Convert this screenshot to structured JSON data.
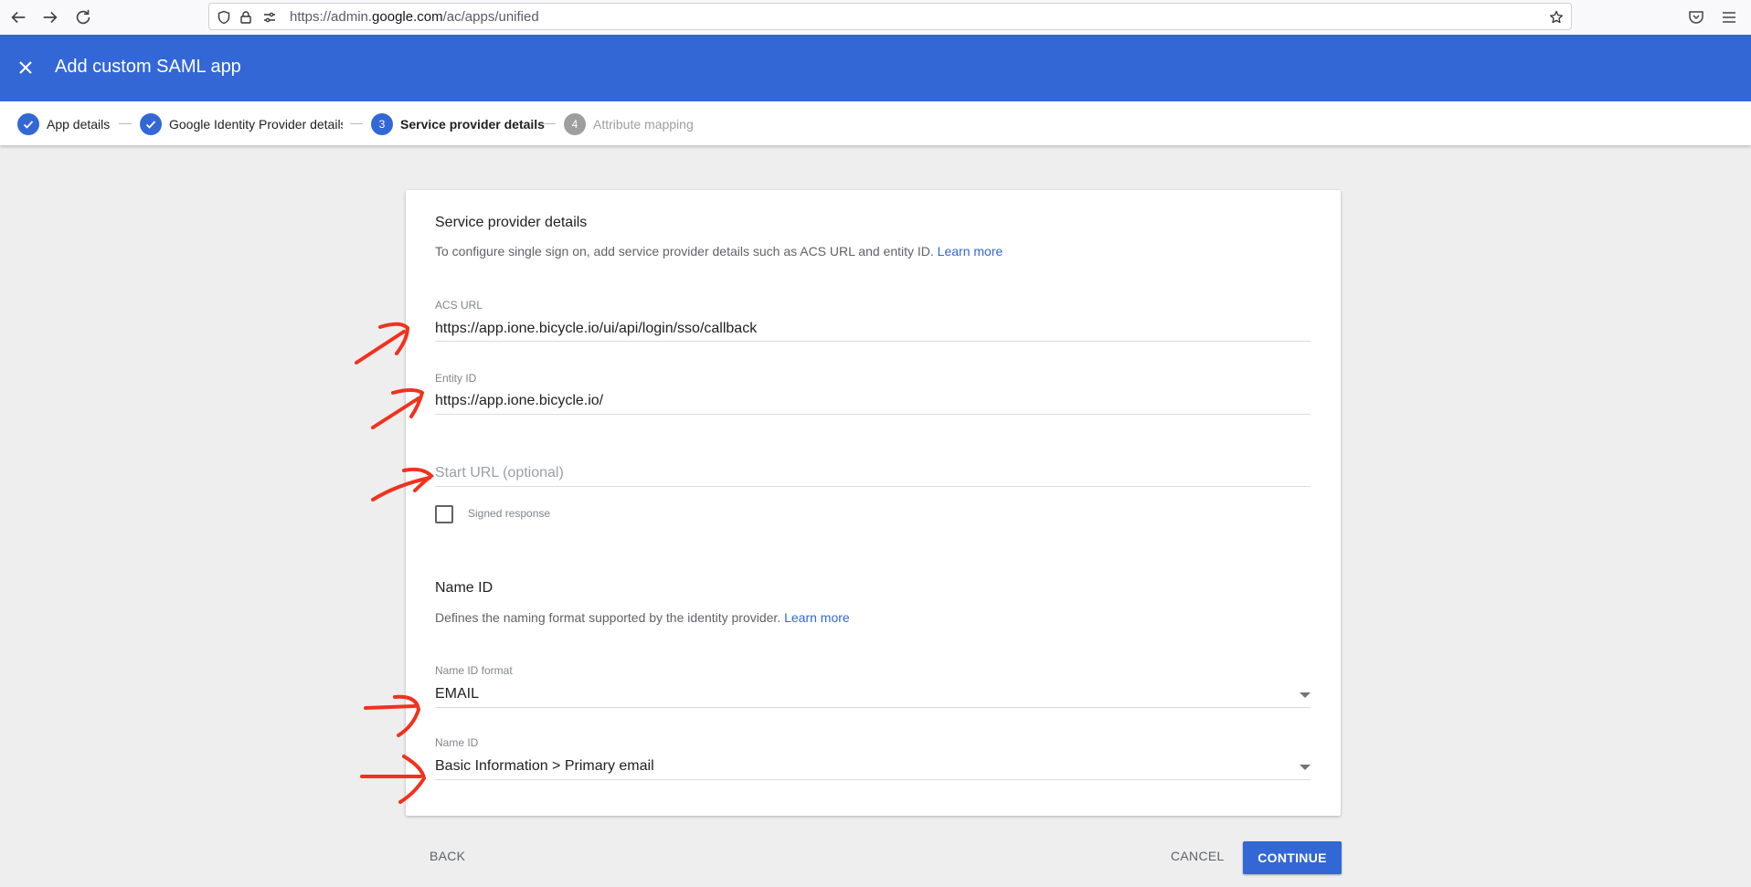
{
  "browser": {
    "url_prefix": "https://admin.",
    "url_domain": "google.com",
    "url_path": "/ac/apps/unified"
  },
  "header": {
    "title": "Add custom SAML app"
  },
  "stepper": {
    "steps": [
      {
        "number": "1",
        "label": "App details",
        "state": "done"
      },
      {
        "number": "2",
        "label": "Google Identity Provider details",
        "state": "done"
      },
      {
        "number": "3",
        "label": "Service provider details",
        "state": "active"
      },
      {
        "number": "4",
        "label": "Attribute mapping",
        "state": "inactive"
      }
    ]
  },
  "card": {
    "sp_title": "Service provider details",
    "sp_desc": "To configure single sign on, add service provider details such as ACS URL and entity ID.",
    "learn_more": "Learn more",
    "acs_label": "ACS URL",
    "acs_value": "https://app.ione.bicycle.io/ui/api/login/sso/callback",
    "entity_label": "Entity ID",
    "entity_value": "https://app.ione.bicycle.io/",
    "start_url_placeholder": "Start URL (optional)",
    "signed_response_label": "Signed response",
    "nameid_title": "Name ID",
    "nameid_desc": "Defines the naming format supported by the identity provider.",
    "nameid_learn_more": "Learn more",
    "nameid_format_label": "Name ID format",
    "nameid_format_value": "EMAIL",
    "nameid_label": "Name ID",
    "nameid_value": "Basic Information > Primary email"
  },
  "footer": {
    "back": "BACK",
    "cancel": "CANCEL",
    "continue": "CONTINUE"
  },
  "colors": {
    "accent": "#3367d6",
    "annotation": "#f0321e"
  }
}
